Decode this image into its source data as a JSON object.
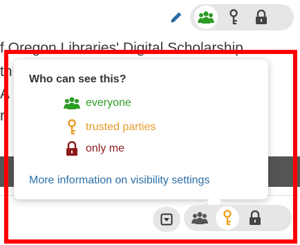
{
  "background": {
    "line1": "f Oregon Libraries' Digital Scholarship",
    "line2": "th",
    "line3": "A",
    "line4": "r"
  },
  "popover": {
    "title": "Who can see this?",
    "options": [
      {
        "label": "everyone",
        "icon": "group-icon",
        "color": "#2e9b25"
      },
      {
        "label": "trusted parties",
        "icon": "key-icon",
        "color": "#e89a2b"
      },
      {
        "label": "only me",
        "icon": "lock-icon",
        "color": "#8b1a1a"
      }
    ],
    "link": "More information on visibility settings"
  },
  "top_control": {
    "selected": "everyone"
  },
  "bottom_control": {
    "selected": "trusted parties"
  }
}
